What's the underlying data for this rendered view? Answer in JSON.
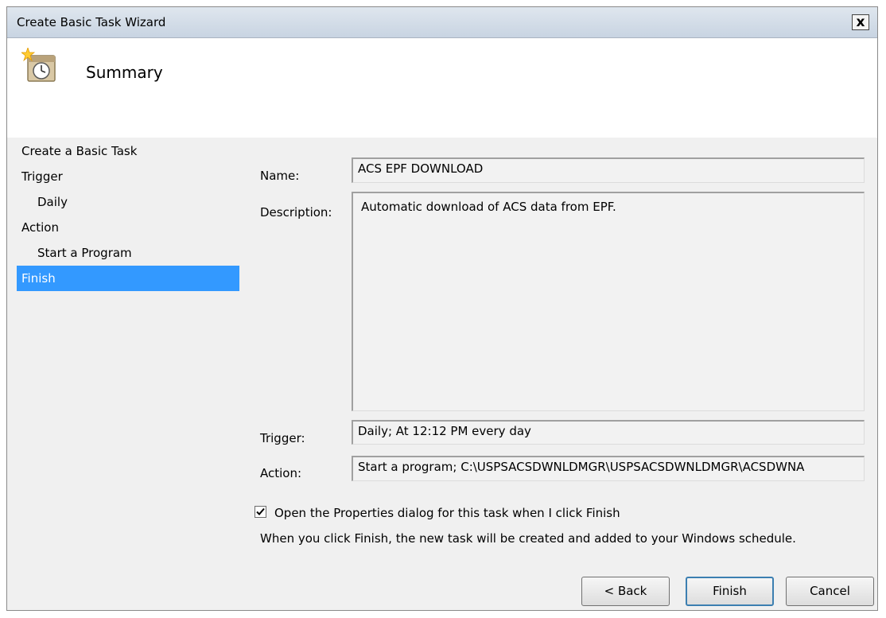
{
  "window": {
    "title": "Create Basic Task Wizard",
    "close_label": "x",
    "close_icon": "close-icon"
  },
  "header": {
    "icon": "task-scheduler-clock-icon",
    "title": "Summary"
  },
  "nav": {
    "items": [
      {
        "label": "Create a Basic Task",
        "indent": false,
        "active": false
      },
      {
        "label": "Trigger",
        "indent": false,
        "active": false
      },
      {
        "label": "Daily",
        "indent": true,
        "active": false
      },
      {
        "label": "Action",
        "indent": false,
        "active": false
      },
      {
        "label": "Start a Program",
        "indent": true,
        "active": false
      },
      {
        "label": "Finish",
        "indent": false,
        "active": true
      }
    ],
    "active_color": "#3399ff"
  },
  "summary": {
    "name_label": "Name:",
    "name_value": "ACS EPF DOWNLOAD",
    "description_label": "Description:",
    "description_value": "Automatic download of ACS data from EPF.",
    "trigger_label": "Trigger:",
    "trigger_value": "Daily; At 12:12 PM every day",
    "action_label": "Action:",
    "action_value": "Start a program; C:\\USPSACSDWNLDMGR\\USPSACSDWNLDMGR\\ACSDWNA"
  },
  "options": {
    "open_properties_label": "Open the Properties dialog for this task when I click Finish",
    "open_properties_checked": true,
    "info_text": "When you click Finish, the new task will be created and added to your Windows schedule."
  },
  "buttons": {
    "back": "< Back",
    "finish": "Finish",
    "cancel": "Cancel"
  }
}
